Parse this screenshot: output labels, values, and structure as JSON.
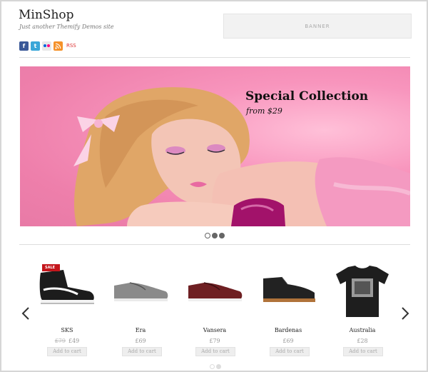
{
  "site": {
    "title": "MinShop",
    "tagline": "Just another Themify Demos site"
  },
  "social": {
    "icons": [
      "facebook-icon",
      "twitter-icon",
      "flickr-icon",
      "rss-icon"
    ],
    "facebook_glyph": "f",
    "twitter_glyph": "t",
    "rss_label": "RSS"
  },
  "banner": {
    "label": "BANNER"
  },
  "slider": {
    "title": "Special Collection",
    "subtitle": "from $29",
    "pager_total": 3,
    "pager_active": 2
  },
  "products": {
    "items": [
      {
        "name": "SKS",
        "old_price": "£79",
        "price": "£49",
        "button": "Add to cart",
        "badge": "SALE"
      },
      {
        "name": "Era",
        "old_price": "",
        "price": "£69",
        "button": "Add to cart",
        "badge": ""
      },
      {
        "name": "Vansera",
        "old_price": "",
        "price": "£79",
        "button": "Add to cart",
        "badge": ""
      },
      {
        "name": "Bardenas",
        "old_price": "",
        "price": "£69",
        "button": "Add to cart",
        "badge": ""
      },
      {
        "name": "Australia",
        "old_price": "",
        "price": "£28",
        "button": "Add to cart",
        "badge": ""
      }
    ],
    "pager_total": 2,
    "pager_active": 2
  },
  "colors": {
    "slide_background": "#ee7fab",
    "sale_badge": "#c4161c",
    "rss": "#f5922a",
    "facebook": "#3b5998",
    "twitter": "#3aa6d8"
  }
}
